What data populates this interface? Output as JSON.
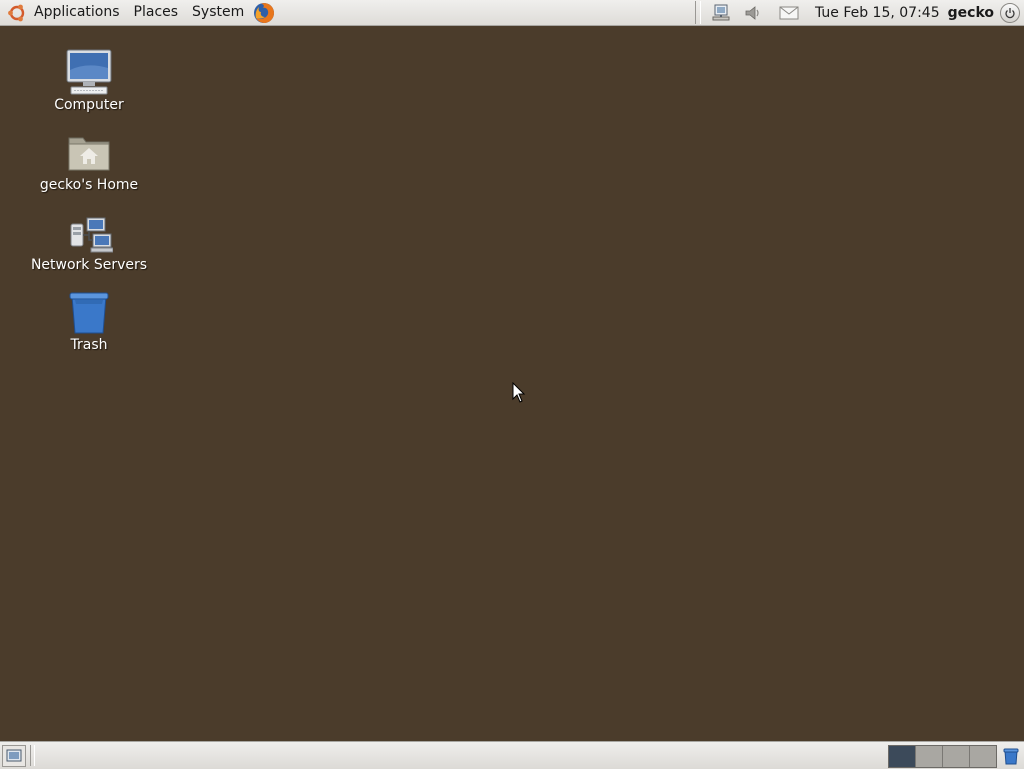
{
  "top_panel": {
    "menus": {
      "applications": "Applications",
      "places": "Places",
      "system": "System"
    },
    "launchers": [
      {
        "icon": "firefox-icon"
      }
    ],
    "tray": {
      "icons": [
        "network-icon",
        "volume-icon",
        "mail-icon"
      ],
      "clock": "Tue Feb 15, 07:45",
      "user": "gecko",
      "power_icon": "power-icon"
    }
  },
  "desktop": {
    "background_color": "#4b3c2b",
    "icons": [
      {
        "label": "Computer",
        "icon": "computer-icon"
      },
      {
        "label": "gecko's Home",
        "icon": "home-folder-icon"
      },
      {
        "label": "Network Servers",
        "icon": "network-servers-icon"
      },
      {
        "label": "Trash",
        "icon": "trash-icon"
      }
    ]
  },
  "bottom_panel": {
    "show_desktop_icon": "show-desktop-icon",
    "workspaces": [
      {
        "active": true
      },
      {
        "active": false
      },
      {
        "active": false
      },
      {
        "active": false
      }
    ],
    "trash_icon": "trash-icon"
  }
}
